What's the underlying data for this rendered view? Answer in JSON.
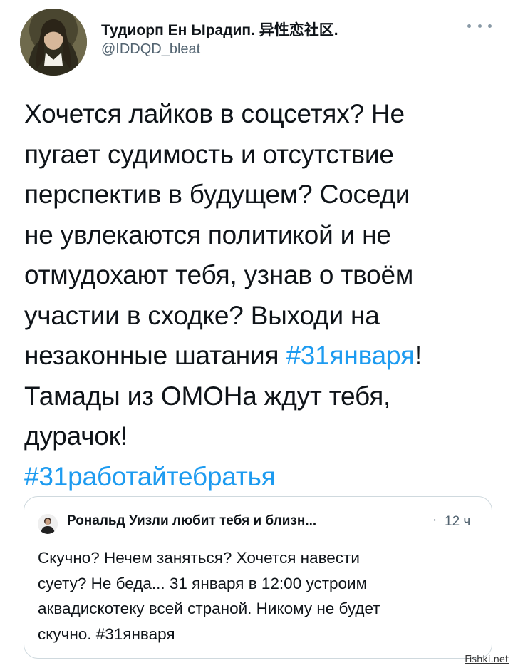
{
  "author": {
    "display_name": "Тудиорп Ен Ырадип. 异性恋社区.",
    "handle": "@IDDQD_bleat"
  },
  "tweet": {
    "lines": [
      [
        {
          "t": "Хочется лайков в соцсетях? Не"
        }
      ],
      [
        {
          "t": "пугает судимость и отсутствие"
        }
      ],
      [
        {
          "t": "перспектив в будущем? Соседи"
        }
      ],
      [
        {
          "t": "не увлекаются политикой и не"
        }
      ],
      [
        {
          "t": "отмудохают тебя, узнав о твоём"
        }
      ],
      [
        {
          "t": "участии в сходке? Выходи на"
        }
      ],
      [
        {
          "t": "незаконные шатания "
        },
        {
          "t": "#31января",
          "tag": true
        },
        {
          "t": "!"
        }
      ],
      [
        {
          "t": "Тамады из ОМОНа ждут тебя,"
        }
      ],
      [
        {
          "t": "дурачок!"
        }
      ],
      [
        {
          "t": "#31работайтебратья",
          "tag": true
        }
      ]
    ]
  },
  "quote": {
    "name": "Рональд Уизли любит тебя и близн...",
    "separator": "·",
    "time": "12 ч",
    "lines": [
      "Скучно? Нечем заняться? Хочется навести",
      "суету? Не беда... 31 января в 12:00 устроим",
      "аквадискотеку всей страной. Никому не будет",
      "скучно. #31января"
    ]
  },
  "watermark": "Fishki.net",
  "colors": {
    "link": "#1d9bf0",
    "text": "#0f1419",
    "secondary": "#536471",
    "border": "#cfd9de"
  },
  "icons": {
    "more": "more-horizontal-icon"
  }
}
